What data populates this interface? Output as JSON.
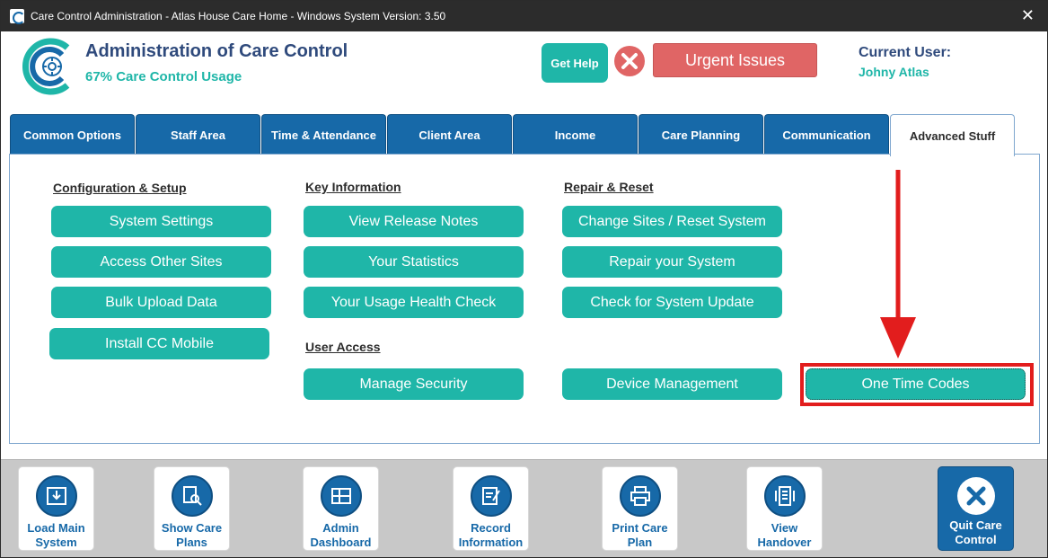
{
  "window": {
    "title": "Care Control Administration - Atlas House Care Home - Windows System Version: 3.50",
    "close_glyph": "✕"
  },
  "header": {
    "app_title": "Administration of Care Control",
    "usage": "67% Care Control Usage",
    "help_label": "Get Help",
    "urgent_label": "Urgent Issues",
    "current_user_label": "Current User:",
    "current_user_name": "Johny Atlas"
  },
  "tabs": [
    {
      "label": "Common Options",
      "active": false
    },
    {
      "label": "Staff Area",
      "active": false
    },
    {
      "label": "Time & Attendance",
      "active": false
    },
    {
      "label": "Client Area",
      "active": false
    },
    {
      "label": "Income",
      "active": false
    },
    {
      "label": "Care Planning",
      "active": false
    },
    {
      "label": "Communication",
      "active": false
    },
    {
      "label": "Advanced Stuff",
      "active": true
    }
  ],
  "sections": {
    "config": {
      "heading": "Configuration & Setup",
      "buttons": [
        "System Settings",
        "Access Other Sites",
        "Bulk Upload Data",
        "Install CC Mobile"
      ]
    },
    "key_info": {
      "heading": "Key Information",
      "buttons": [
        "View Release Notes",
        "Your Statistics",
        "Your Usage Health Check"
      ]
    },
    "repair": {
      "heading": "Repair & Reset",
      "buttons": [
        "Change Sites / Reset System",
        "Repair your System",
        "Check for System Update"
      ]
    },
    "user_access": {
      "heading": "User Access",
      "buttons": [
        "Manage Security"
      ]
    },
    "extra": {
      "buttons": [
        "Device Management",
        "One Time Codes"
      ]
    }
  },
  "bottom_nav": [
    {
      "label": "Load Main System",
      "icon": "load-system-icon"
    },
    {
      "label": "Show Care Plans",
      "icon": "care-plans-icon"
    },
    {
      "label": "Admin Dashboard",
      "icon": "dashboard-icon"
    },
    {
      "label": "Record Information",
      "icon": "record-icon"
    },
    {
      "label": "Print Care Plan",
      "icon": "printer-icon"
    },
    {
      "label": "View Handover",
      "icon": "handover-icon"
    },
    {
      "label": "Quit Care Control",
      "icon": "quit-icon"
    }
  ],
  "colors": {
    "teal": "#1fb6a8",
    "navy": "#2f4a7c",
    "tab_blue": "#1769a8",
    "urgent_red": "#e06565",
    "highlight_red": "#e21d1d"
  }
}
